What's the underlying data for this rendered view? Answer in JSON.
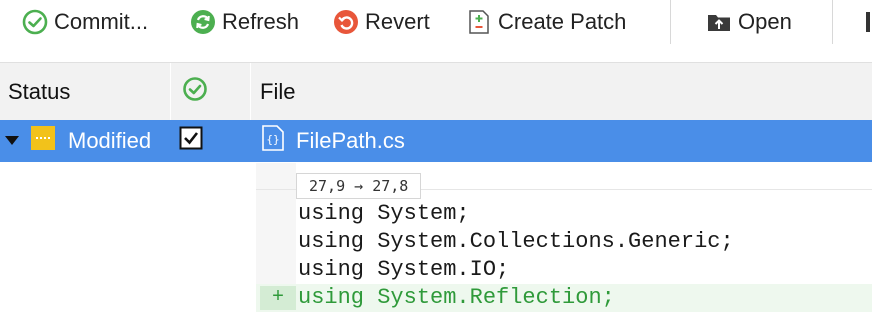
{
  "toolbar": {
    "commit_label": "Commit...",
    "refresh_label": "Refresh",
    "revert_label": "Revert",
    "create_patch_label": "Create Patch",
    "open_label": "Open"
  },
  "columns": {
    "status": "Status",
    "file": "File"
  },
  "row": {
    "status": "Modified",
    "checked": true,
    "file": "FilePath.cs"
  },
  "diff": {
    "hunk": "27,9 → 27,8",
    "lines": [
      {
        "text": "using System;",
        "type": "context"
      },
      {
        "text": "using System.Collections.Generic;",
        "type": "context"
      },
      {
        "text": "using System.IO;",
        "type": "context"
      },
      {
        "text": "using System.Reflection;",
        "type": "added",
        "marker": "+"
      }
    ]
  },
  "colors": {
    "selection": "#4a8ee8",
    "added_text": "#2f9a3a",
    "added_bg": "#eef8ee",
    "commit_icon": "#4caf50",
    "refresh_icon": "#4caf50",
    "revert_icon": "#e8563a",
    "modified_badge": "#f2c21b"
  },
  "icons": {
    "commit": "check-circle-icon",
    "refresh": "refresh-icon",
    "revert": "revert-icon",
    "create_patch": "patch-file-icon",
    "open": "open-folder-icon",
    "status_column": "check-circle-icon",
    "file_type": "code-file-icon"
  }
}
